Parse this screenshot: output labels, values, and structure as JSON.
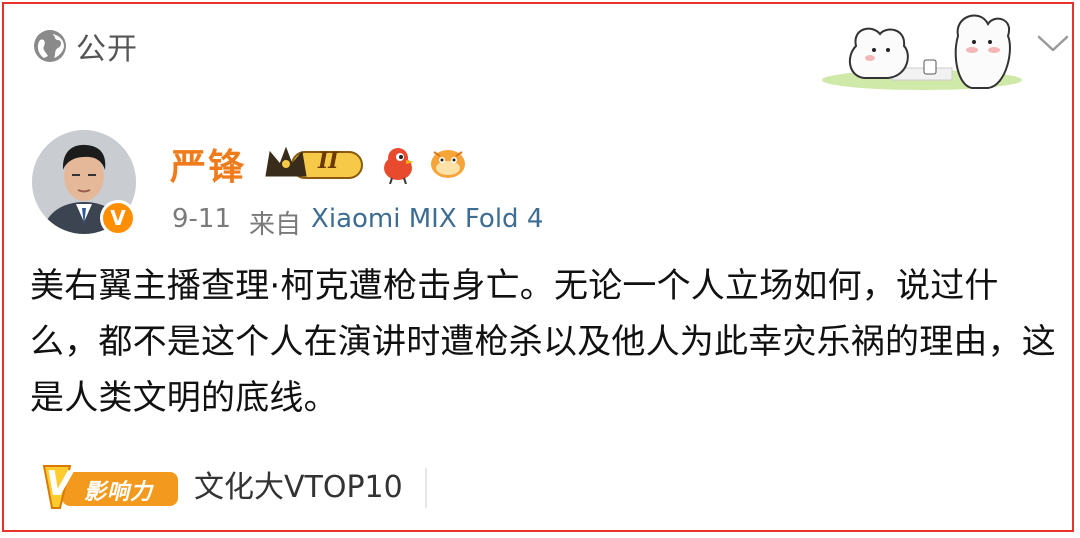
{
  "visibility": {
    "label": "公开",
    "icon": "globe-icon"
  },
  "author": {
    "name": "严锋",
    "level_badge": "II",
    "verified_mark": "V"
  },
  "meta": {
    "date": "9-11",
    "source_prefix": "来自",
    "source_device": "Xiaomi MIX Fold 4"
  },
  "post": {
    "text": "美右翼主播查理·柯克遭枪击身亡。无论一个人立场如何，说过什么，都不是这个人在演讲时遭枪杀以及他人为此幸灾乐祸的理由，这是人类文明的底线。"
  },
  "tag": {
    "badge_label": "影响力",
    "badge_letter": "V",
    "text": "文化大VTOP10"
  },
  "colors": {
    "name": "#f07b1b",
    "source": "#3e6d94",
    "border": "#e8332b",
    "badge": "#ff8f00"
  }
}
